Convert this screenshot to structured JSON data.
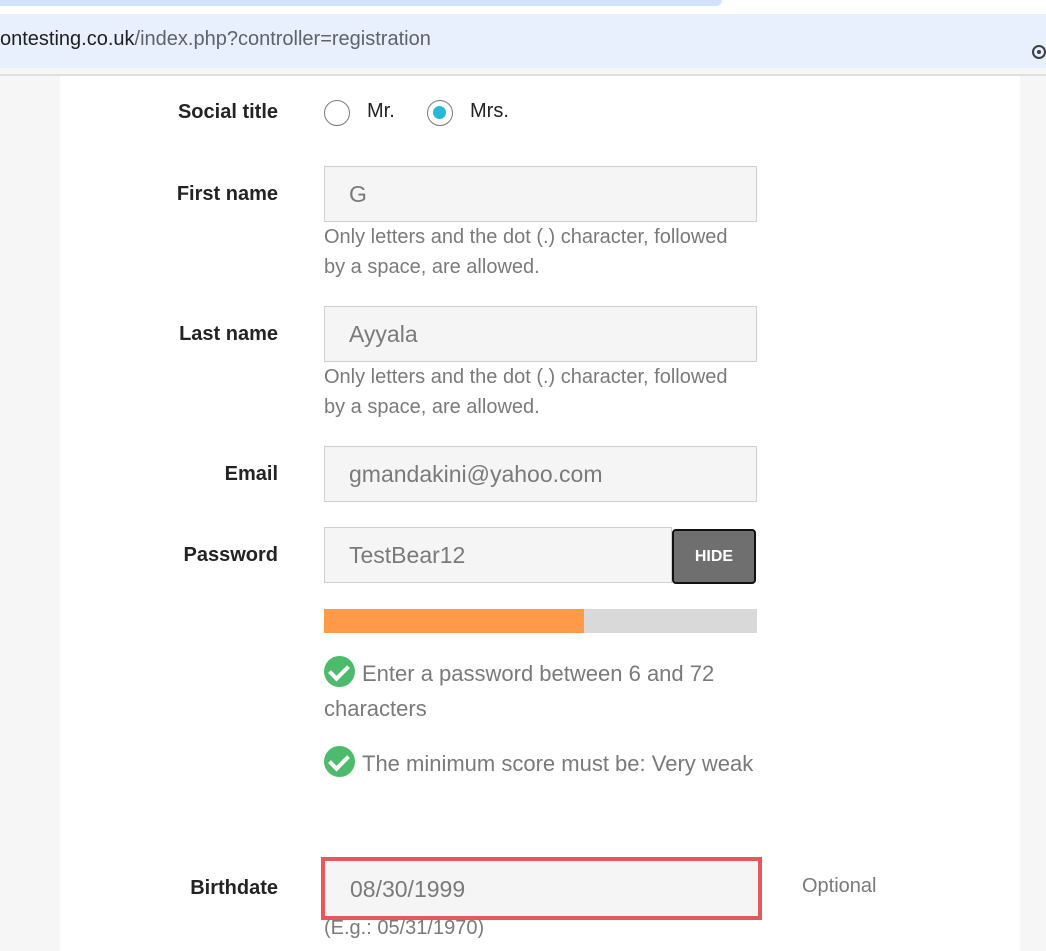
{
  "browser": {
    "url_host": "ontesting.co.uk",
    "url_path": "/index.php?controller=registration"
  },
  "form": {
    "social_title": {
      "label": "Social title",
      "options": [
        {
          "label": "Mr.",
          "checked": false
        },
        {
          "label": "Mrs.",
          "checked": true
        }
      ]
    },
    "first_name": {
      "label": "First name",
      "value": "G",
      "help": "Only letters and the dot (.) character, followed by a space, are allowed."
    },
    "last_name": {
      "label": "Last name",
      "value": "Ayyala",
      "help": "Only letters and the dot (.) character, followed by a space, are allowed."
    },
    "email": {
      "label": "Email",
      "value": "gmandakini@yahoo.com"
    },
    "password": {
      "label": "Password",
      "value": "TestBear12",
      "toggle_label": "HIDE",
      "strength_fraction": 0.6,
      "rules": [
        "Enter a password between 6 and 72 characters",
        "The minimum score must be: Very weak"
      ]
    },
    "birthdate": {
      "label": "Birthdate",
      "value": "08/30/1999",
      "optional_label": "Optional",
      "help": "(E.g.: 05/31/1970)"
    }
  },
  "colors": {
    "radio_checked": "#24b9d7",
    "strength_fill": "#ff9a4a",
    "check_ok": "#4cbb6c",
    "highlight_border": "#e8575a"
  }
}
